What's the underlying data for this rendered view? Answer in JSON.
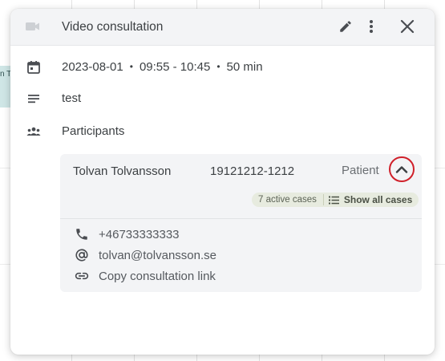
{
  "background": {
    "event_label": "n To"
  },
  "header": {
    "icon": "videocam-icon",
    "title": "Video consultation",
    "edit_icon": "pencil-icon",
    "more_icon": "more-vertical-icon",
    "close_icon": "close-icon"
  },
  "details": {
    "date_icon": "calendar-icon",
    "date": "2023-08-01",
    "time": "09:55 - 10:45",
    "duration": "50 min",
    "separator": "•",
    "notes_icon": "notes-icon",
    "notes": "test",
    "participants_icon": "group-icon",
    "participants_label": "Participants"
  },
  "participant": {
    "name": "Tolvan Tolvansson",
    "personal_id": "19121212-1212",
    "role": "Patient",
    "expand_icon": "chevron-up-icon",
    "active_cases": "7 active cases",
    "show_all_icon": "list-icon",
    "show_all_label": "Show all cases",
    "contacts": [
      {
        "icon": "phone-icon",
        "text": "+46733333333"
      },
      {
        "icon": "at-sign-icon",
        "text": "tolvan@tolvansson.se"
      },
      {
        "icon": "link-icon",
        "text": "Copy consultation link"
      }
    ]
  },
  "colors": {
    "header_bg": "#f3f4f6",
    "card_bg": "#f3f4f6",
    "badge_bg": "#e7ebdf",
    "highlight_ring": "#d0202a",
    "event_bg": "#cfe6e6"
  }
}
